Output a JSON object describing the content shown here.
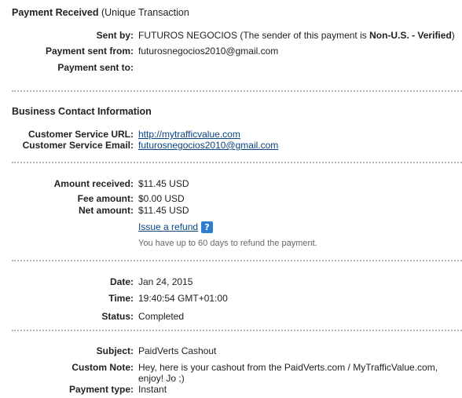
{
  "header": {
    "title_bold": "Payment Received",
    "title_rest": " (Unique Transaction"
  },
  "sender": {
    "sent_by_label": "Sent by:",
    "sent_by_name": "FUTUROS NEGOCIOS",
    "sent_by_note_prefix": " (The sender of this payment is ",
    "sent_by_note_bold": "Non-U.S. - Verified",
    "sent_by_note_suffix": ")",
    "sent_from_label": "Payment sent from:",
    "sent_from_value": "futurosnegocios2010@gmail.com",
    "sent_to_label": "Payment sent to:",
    "sent_to_value": ""
  },
  "business": {
    "heading": "Business Contact Information",
    "service_url_label": "Customer Service URL:",
    "service_url_value": "http://mytrafficvalue.com",
    "service_email_label": "Customer Service Email:",
    "service_email_value": "futurosnegocios2010@gmail.com"
  },
  "amounts": {
    "received_label": "Amount received:",
    "received_value": "$11.45 USD",
    "fee_label": "Fee amount:",
    "fee_value": "$0.00 USD",
    "net_label": "Net amount:",
    "net_value": "$11.45 USD",
    "refund_link": "Issue a refund",
    "help_icon_glyph": "?",
    "refund_note": "You have up to 60 days to refund the payment."
  },
  "timing": {
    "date_label": "Date:",
    "date_value": "Jan 24, 2015",
    "time_label": "Time:",
    "time_value": "19:40:54 GMT+01:00",
    "status_label": "Status:",
    "status_value": "Completed"
  },
  "details": {
    "subject_label": "Subject:",
    "subject_value": "PaidVerts Cashout",
    "note_label": "Custom Note:",
    "note_line1": "Hey, here is your cashout from the PaidVerts.com / MyTrafficValue.com,",
    "note_line2": "enjoy! Jo ;)",
    "payment_type_label": "Payment type:",
    "payment_type_value": "Instant"
  },
  "colors": {
    "link": "#084482",
    "help_icon": "#2d7dd2",
    "divider": "#b4b4b4"
  },
  "icons": {
    "help": "question-mark-icon"
  }
}
